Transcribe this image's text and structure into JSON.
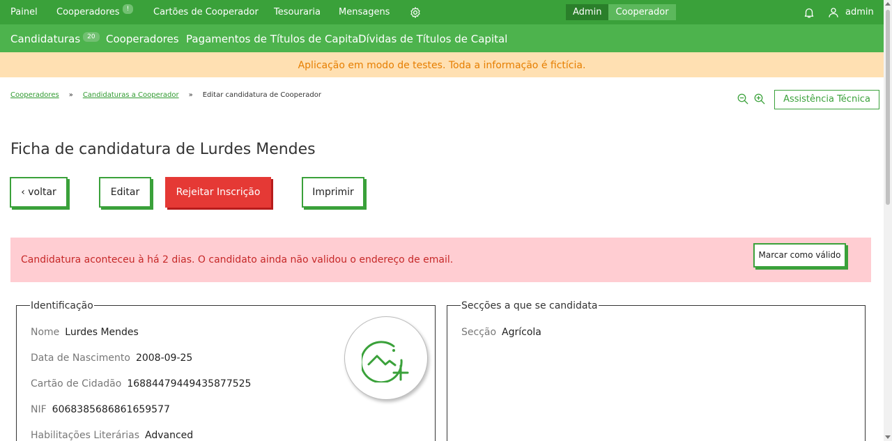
{
  "topnav": {
    "items": [
      "Painel",
      "Cooperadores",
      "Cartões de Cooperador",
      "Tesouraria",
      "Mensagens"
    ],
    "cooperadores_badge": "!",
    "settings_icon": "gear-icon",
    "mode_admin": "Admin",
    "mode_cooperador": "Cooperador",
    "notifications_icon": "bell-icon",
    "user_icon": "user-icon",
    "username": "admin"
  },
  "subnav": {
    "items": [
      "Candidaturas",
      "Cooperadores",
      "Pagamentos de Títulos de Capital",
      "Dívidas de Títulos de Capital"
    ],
    "candidaturas_badge": "20"
  },
  "banner": {
    "text": "Aplicação em modo de testes. Toda a informação é fictícia."
  },
  "breadcrumb": {
    "items": [
      "Cooperadores",
      "Candidaturas a Cooperador",
      "Editar candidatura de Cooperador"
    ],
    "separator": "»"
  },
  "toolbar": {
    "zoom_out_icon": "zoom-out-icon",
    "zoom_in_icon": "zoom-in-icon",
    "support_label": "Assistência Técnica"
  },
  "page": {
    "title": "Ficha de candidatura de Lurdes Mendes"
  },
  "actions": {
    "back": "‹ voltar",
    "edit": "Editar",
    "reject": "Rejeitar Inscrição",
    "print": "Imprimir"
  },
  "alert": {
    "text": "Candidatura aconteceu à há 2 dias. O candidato ainda não validou o endereço de email.",
    "button": "Marcar como válido"
  },
  "identification": {
    "legend": "Identificação",
    "fields": [
      {
        "label": "Nome",
        "value": "Lurdes Mendes"
      },
      {
        "label": "Data de Nascimento",
        "value": "2008-09-25"
      },
      {
        "label": "Cartão de Cidadão",
        "value": "16884479449435877525"
      },
      {
        "label": "NIF",
        "value": "6068385686861659577"
      },
      {
        "label": "Habilitações Literárias",
        "value": "Advanced"
      }
    ],
    "photo_icon": "add-photo-icon"
  },
  "sections": {
    "legend": "Secções a que se candidata",
    "fields": [
      {
        "label": "Secção",
        "value": "Agrícola"
      }
    ]
  },
  "colors": {
    "primary": "#3aa13a",
    "subnav": "#4db34d",
    "danger": "#e53935",
    "alert_bg": "#ffcdd2",
    "banner_bg": "#ffe0b2"
  }
}
